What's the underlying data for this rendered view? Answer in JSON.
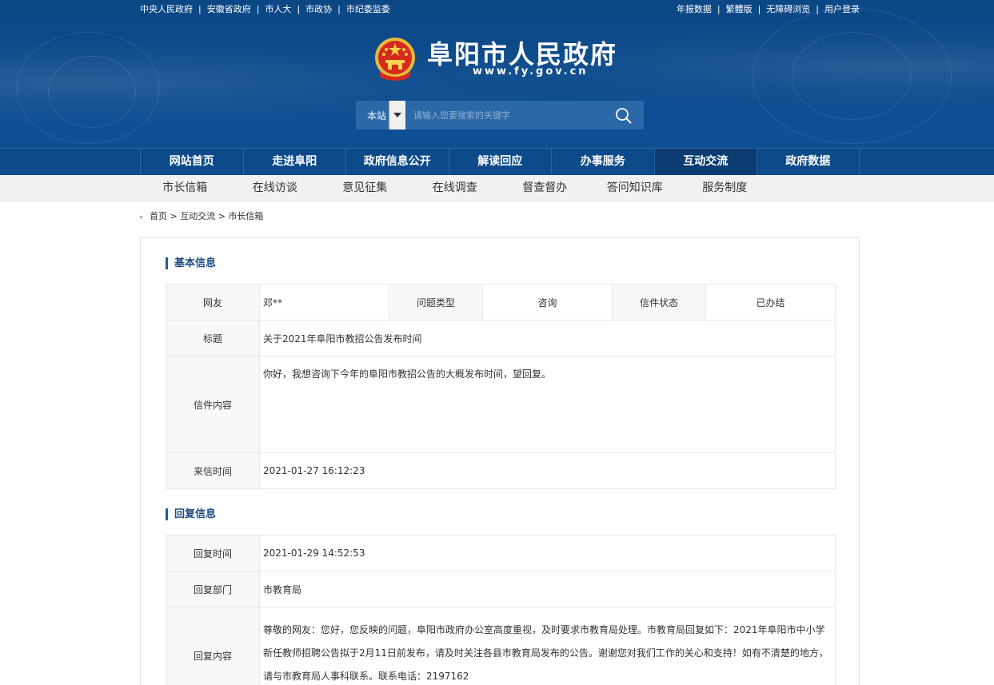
{
  "top_links_left": [
    "中央人民政府",
    "安徽省政府",
    "市人大",
    "市政协",
    "市纪委监委"
  ],
  "top_links_right": [
    "年报数据",
    "繁體版",
    "无障碍浏览",
    "用户登录"
  ],
  "site": {
    "title": "阜阳市人民政府",
    "url": "www.fy.gov.cn"
  },
  "search": {
    "scope": "本站",
    "placeholder": "请输入您要搜索的关键字"
  },
  "main_nav": [
    {
      "label": "网站首页"
    },
    {
      "label": "走进阜阳"
    },
    {
      "label": "政府信息公开"
    },
    {
      "label": "解读回应"
    },
    {
      "label": "办事服务"
    },
    {
      "label": "互动交流",
      "active": true
    },
    {
      "label": "政府数据"
    }
  ],
  "sub_nav": [
    "市长信箱",
    "在线访谈",
    "意见征集",
    "在线调查",
    "督查督办",
    "答问知识库",
    "服务制度"
  ],
  "breadcrumb": {
    "home": "首页",
    "section": "互动交流",
    "current": "市长信箱"
  },
  "basic_info": {
    "title": "基本信息",
    "netizen_label": "网友",
    "netizen_value": "邓**",
    "type_label": "问题类型",
    "type_value": "咨询",
    "status_label": "信件状态",
    "status_value": "已办结",
    "subject_label": "标题",
    "subject_value": "关于2021年阜阳市教招公告发布时间",
    "content_label": "信件内容",
    "content_value": "你好，我想咨询下今年的阜阳市教招公告的大概发布时间，望回复。",
    "time_label": "来信时间",
    "time_value": "2021-01-27 16:12:23"
  },
  "reply_info": {
    "title": "回复信息",
    "time_label": "回复时间",
    "time_value": "2021-01-29 14:52:53",
    "dept_label": "回复部门",
    "dept_value": "市教育局",
    "content_label": "回复内容",
    "content_value": "尊敬的网友：您好，您反映的问题，阜阳市政府办公室高度重视，及时要求市教育局处理。市教育局回复如下：2021年阜阳市中小学新任教师招聘公告拟于2月11日前发布，请及时关注各县市教育局发布的公告。谢谢您对我们工作的关心和支持！如有不清楚的地方，请与市教育局人事科联系。联系电话：2197162"
  },
  "colors": {
    "header_blue": "#0d4a8a",
    "nav_active": "#0a3c72",
    "label_blue": "#1e5ea8"
  }
}
